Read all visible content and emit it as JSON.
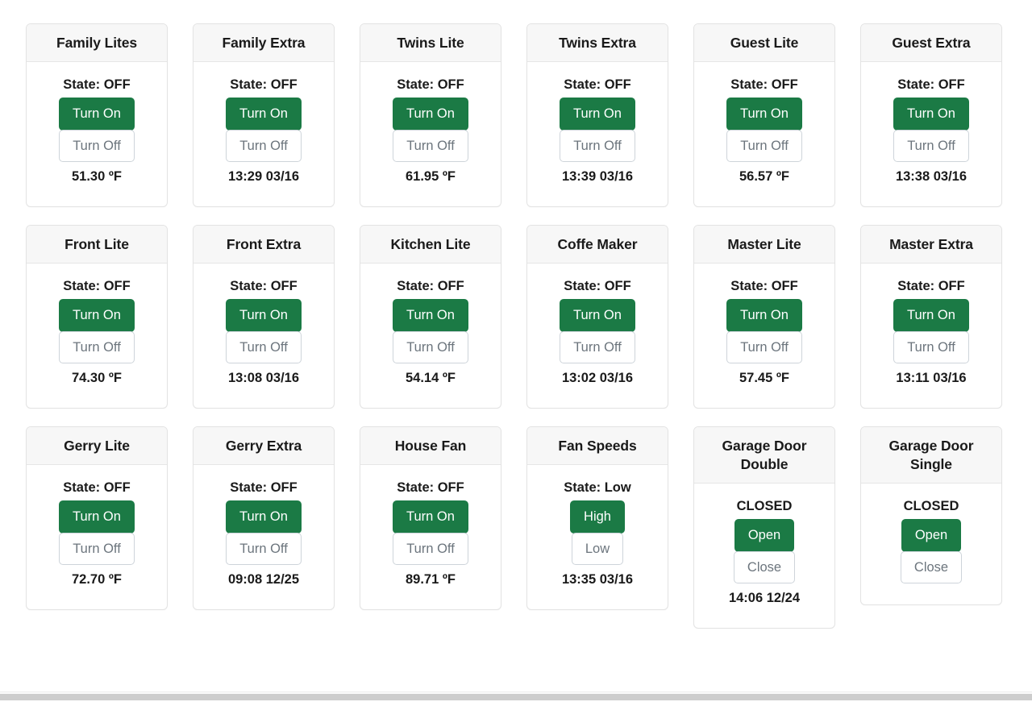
{
  "theme": {
    "accent_green": "#1b7a45",
    "muted_text": "#6c757d",
    "header_bg": "#f7f7f7",
    "card_border": "#e3e3e3"
  },
  "cards": [
    {
      "title": "Family Lites",
      "status": "State: OFF",
      "primary_button": "Turn On",
      "secondary_button": "Turn Off",
      "reading": "51.30 ºF"
    },
    {
      "title": "Family Extra",
      "status": "State: OFF",
      "primary_button": "Turn On",
      "secondary_button": "Turn Off",
      "reading": "13:29 03/16"
    },
    {
      "title": "Twins Lite",
      "status": "State: OFF",
      "primary_button": "Turn On",
      "secondary_button": "Turn Off",
      "reading": "61.95 ºF"
    },
    {
      "title": "Twins Extra",
      "status": "State: OFF",
      "primary_button": "Turn On",
      "secondary_button": "Turn Off",
      "reading": "13:39 03/16"
    },
    {
      "title": "Guest Lite",
      "status": "State: OFF",
      "primary_button": "Turn On",
      "secondary_button": "Turn Off",
      "reading": "56.57 ºF"
    },
    {
      "title": "Guest Extra",
      "status": "State: OFF",
      "primary_button": "Turn On",
      "secondary_button": "Turn Off",
      "reading": "13:38 03/16"
    },
    {
      "title": "Front Lite",
      "status": "State: OFF",
      "primary_button": "Turn On",
      "secondary_button": "Turn Off",
      "reading": "74.30 ºF"
    },
    {
      "title": "Front Extra",
      "status": "State: OFF",
      "primary_button": "Turn On",
      "secondary_button": "Turn Off",
      "reading": "13:08 03/16"
    },
    {
      "title": "Kitchen Lite",
      "status": "State: OFF",
      "primary_button": "Turn On",
      "secondary_button": "Turn Off",
      "reading": "54.14 ºF"
    },
    {
      "title": "Coffe Maker",
      "status": "State: OFF",
      "primary_button": "Turn On",
      "secondary_button": "Turn Off",
      "reading": "13:02 03/16"
    },
    {
      "title": "Master Lite",
      "status": "State: OFF",
      "primary_button": "Turn On",
      "secondary_button": "Turn Off",
      "reading": "57.45 ºF"
    },
    {
      "title": "Master Extra",
      "status": "State: OFF",
      "primary_button": "Turn On",
      "secondary_button": "Turn Off",
      "reading": "13:11 03/16"
    },
    {
      "title": "Gerry Lite",
      "status": "State: OFF",
      "primary_button": "Turn On",
      "secondary_button": "Turn Off",
      "reading": "72.70 ºF"
    },
    {
      "title": "Gerry Extra",
      "status": "State: OFF",
      "primary_button": "Turn On",
      "secondary_button": "Turn Off",
      "reading": "09:08 12/25"
    },
    {
      "title": "House Fan",
      "status": "State: OFF",
      "primary_button": "Turn On",
      "secondary_button": "Turn Off",
      "reading": "89.71 ºF"
    },
    {
      "title": "Fan Speeds",
      "status": "State: Low",
      "primary_button": "High",
      "secondary_button": "Low",
      "reading": "13:35 03/16"
    },
    {
      "title": "Garage Door Double",
      "status": "CLOSED",
      "primary_button": "Open",
      "secondary_button": "Close",
      "reading": "14:06 12/24"
    },
    {
      "title": "Garage Door Single",
      "status": "CLOSED",
      "primary_button": "Open",
      "secondary_button": "Close",
      "reading": ""
    }
  ]
}
